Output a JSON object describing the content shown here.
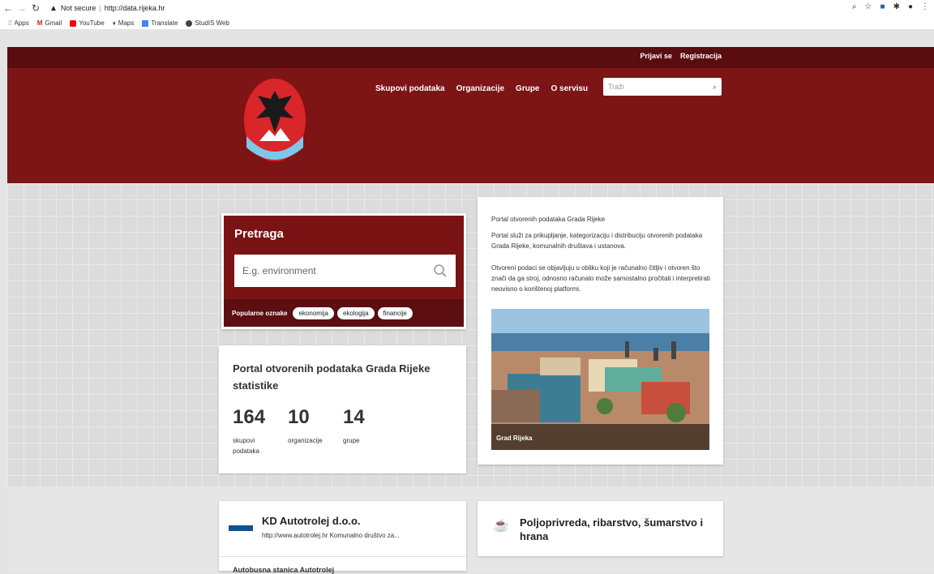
{
  "browser": {
    "security_label": "Not secure",
    "url": "http://data.rijeka.hr",
    "bookmarks": [
      "Apps",
      "Gmail",
      "YouTube",
      "Maps",
      "Translate",
      "StudIS Web"
    ]
  },
  "header": {
    "top_links": [
      "Prijavi se",
      "Registracija"
    ],
    "menu": [
      "Skupovi podataka",
      "Organizacije",
      "Grupe",
      "O servisu"
    ],
    "search_placeholder": "Traži",
    "brand_color": "#7d1416"
  },
  "search_panel": {
    "title": "Pretraga",
    "placeholder": "E.g. environment",
    "tags_label": "Popularne oznake",
    "tags": [
      "ekonomija",
      "ekologija",
      "financije"
    ]
  },
  "stats": {
    "title": "Portal otvorenih podataka Grada Rijeke statistike",
    "items": [
      {
        "value": "164",
        "label": "skupovi podataka"
      },
      {
        "value": "10",
        "label": "organizacije"
      },
      {
        "value": "14",
        "label": "grupe"
      }
    ]
  },
  "intro": {
    "p1": "Portal otvorenih podataka Grada Rijeke",
    "p2": "Portal služi za prikupljanje, kategorizaciju i distribuciju otvorenih podataka Grada Rijeke, komunalnih društava i ustanova.",
    "p3": "Otvoreni podaci se objavljuju u obliku koji je računalno čitljiv i otvoren što znači da ga stroj, odnosno računalo može samostalno pročitati i interpretirati neovisno o korištenoj platformi.",
    "image_caption": "Grad Rijeka"
  },
  "featured_org": {
    "title": "KD Autotrolej d.o.o.",
    "description": "http://www.autotrolej.hr Komunalno društvo za...",
    "next_item": "Autobusna stanica Autotrolej"
  },
  "featured_group": {
    "title": "Poljoprivreda, ribarstvo, šumarstvo i hrana"
  }
}
